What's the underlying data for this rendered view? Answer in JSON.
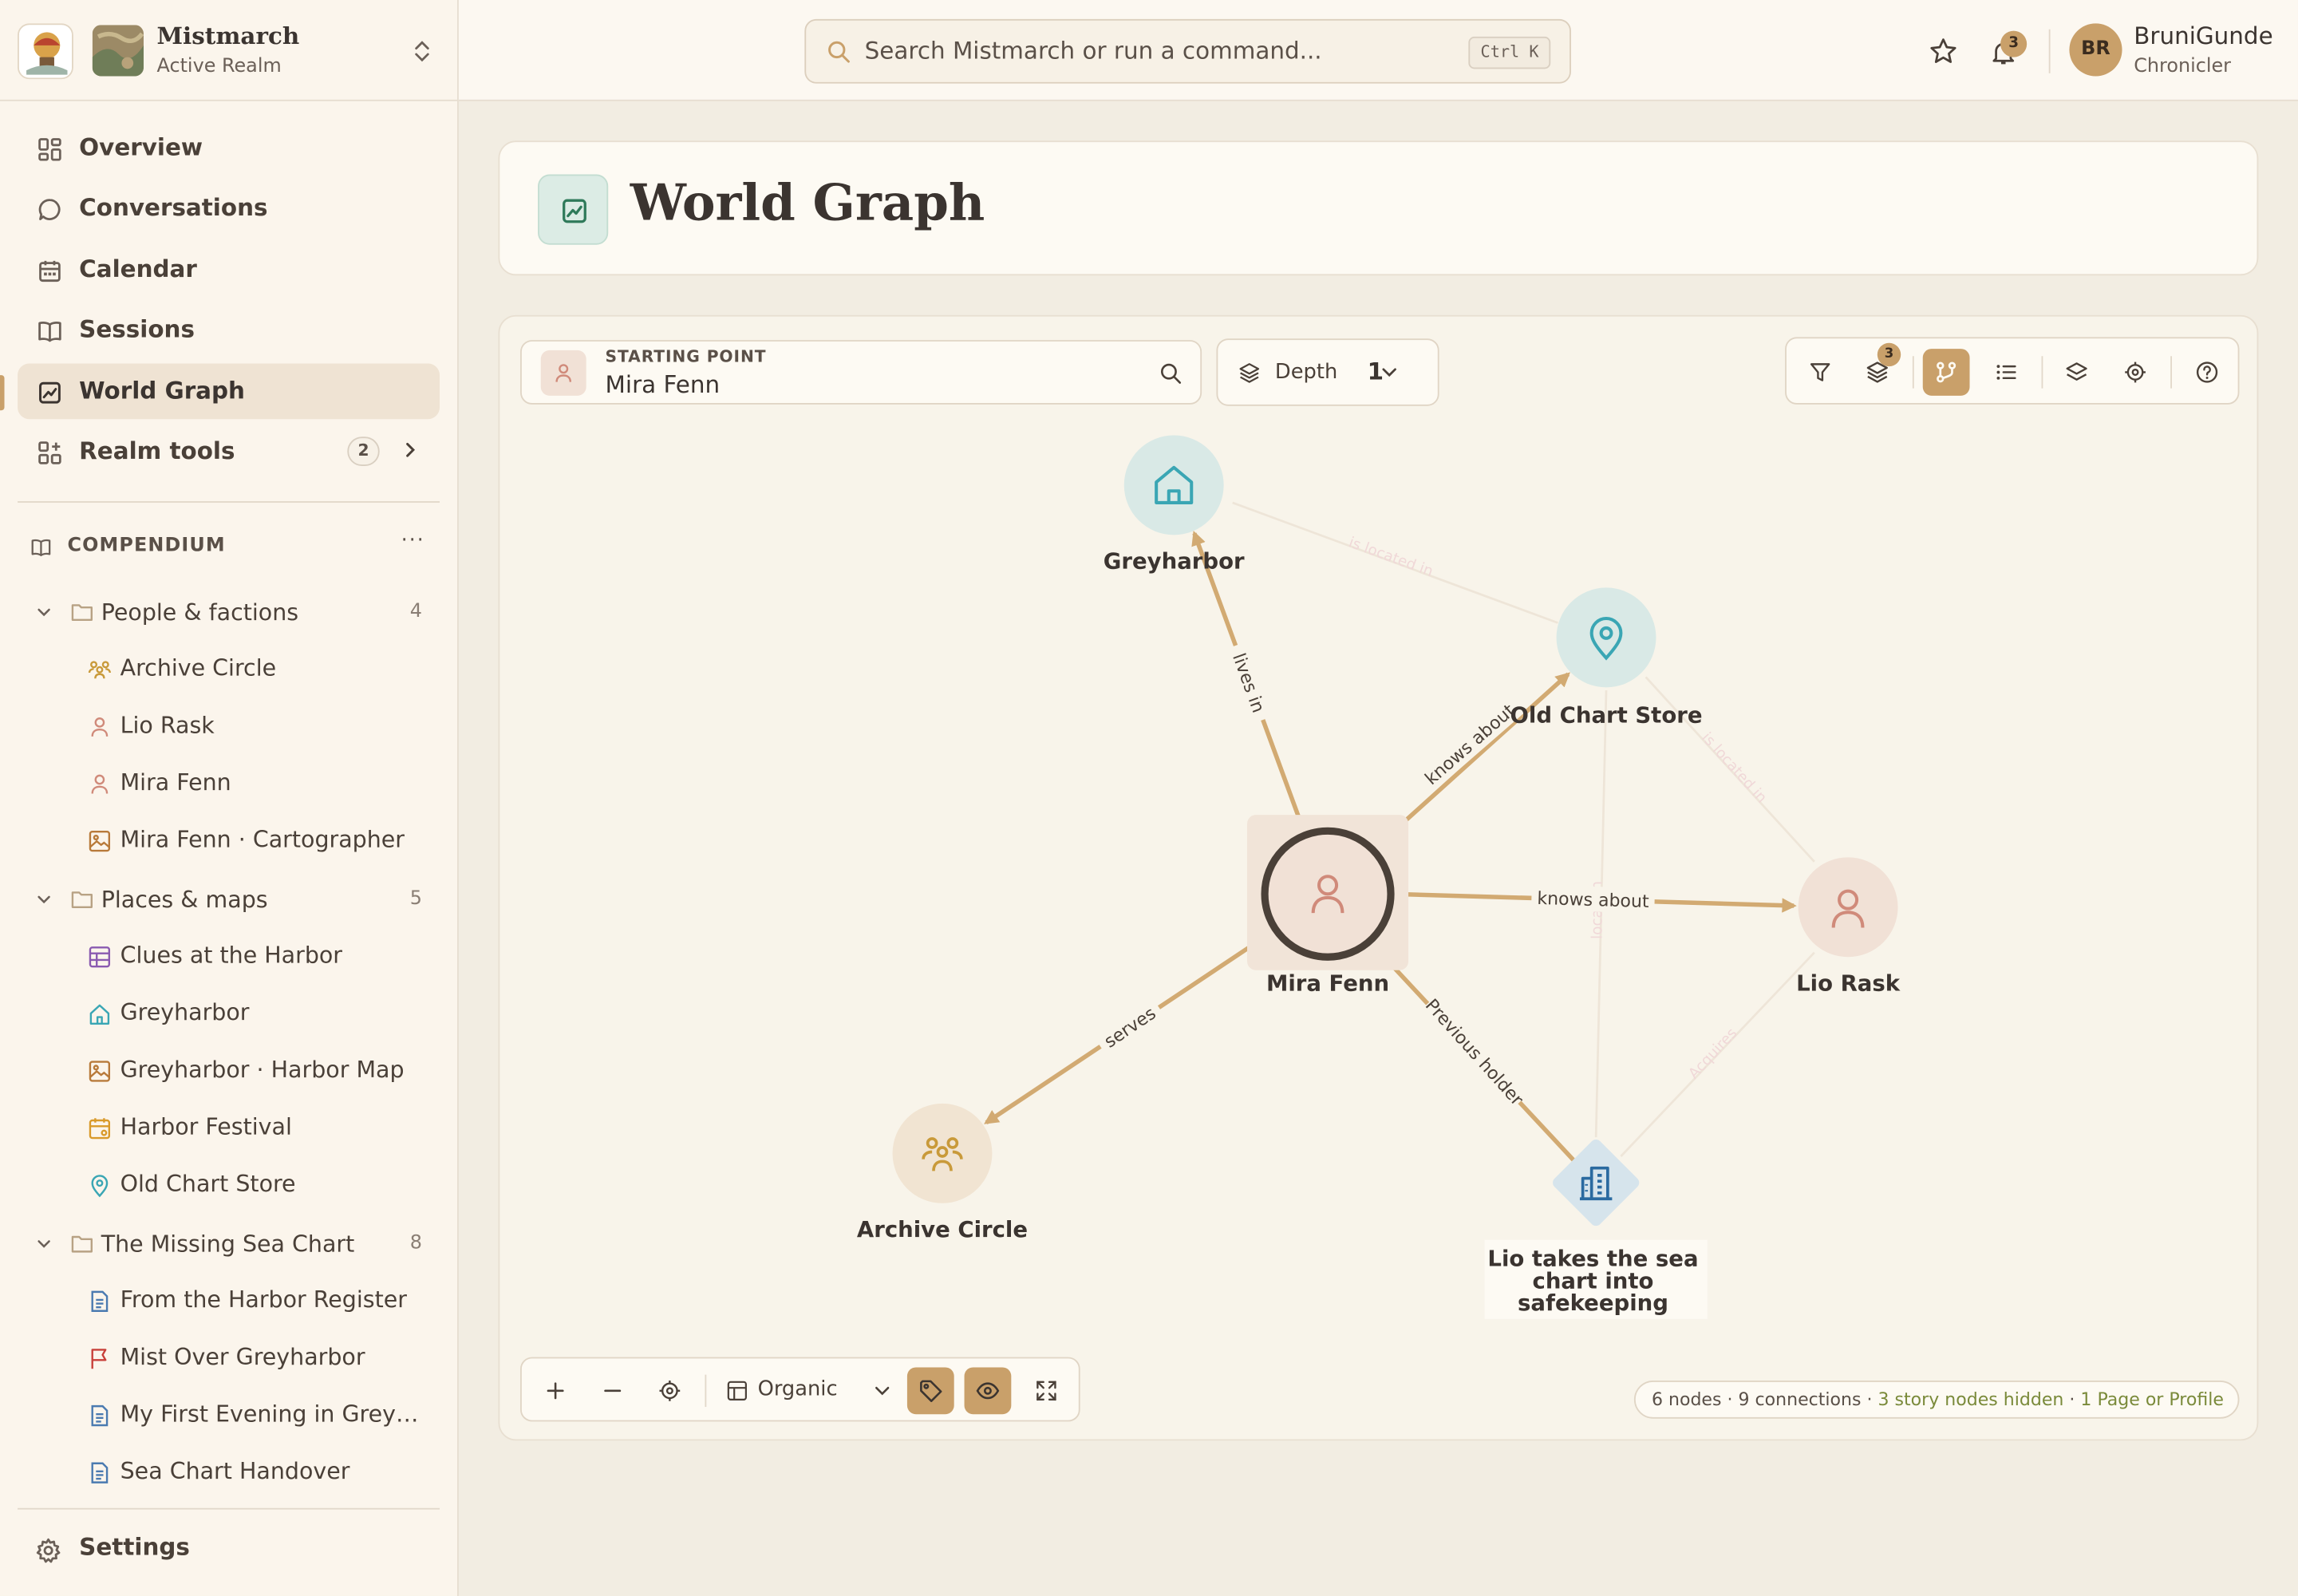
{
  "realm": {
    "name": "Mistmarch",
    "status": "Active Realm"
  },
  "nav": [
    {
      "label": "Overview",
      "icon": "grid-icon"
    },
    {
      "label": "Conversations",
      "icon": "chat-icon"
    },
    {
      "label": "Calendar",
      "icon": "calendar-icon"
    },
    {
      "label": "Sessions",
      "icon": "book-icon"
    },
    {
      "label": "World Graph",
      "icon": "graph-icon",
      "active": true
    },
    {
      "label": "Realm tools",
      "icon": "apps-icon",
      "badge": "2"
    }
  ],
  "compendium": {
    "title": "COMPENDIUM",
    "folders": [
      {
        "label": "People & factions",
        "count": "4",
        "items": [
          {
            "label": "Archive Circle",
            "icon": "group-icon"
          },
          {
            "label": "Lio Rask",
            "icon": "person-icon"
          },
          {
            "label": "Mira Fenn",
            "icon": "person-icon"
          },
          {
            "label": "Mira Fenn · Cartographer",
            "icon": "image-icon"
          }
        ]
      },
      {
        "label": "Places & maps",
        "count": "5",
        "items": [
          {
            "label": "Clues at the Harbor",
            "icon": "table-icon"
          },
          {
            "label": "Greyharbor",
            "icon": "home-icon"
          },
          {
            "label": "Greyharbor · Harbor Map",
            "icon": "image-icon"
          },
          {
            "label": "Harbor Festival",
            "icon": "calendar-icon"
          },
          {
            "label": "Old Chart Store",
            "icon": "pin-icon"
          }
        ]
      },
      {
        "label": "The Missing Sea Chart",
        "count": "8",
        "items": [
          {
            "label": "From the Harbor Register",
            "icon": "doc-icon"
          },
          {
            "label": "Mist Over Greyharbor",
            "icon": "flag-icon"
          },
          {
            "label": "My First Evening in Grey…",
            "icon": "doc-icon"
          },
          {
            "label": "Sea Chart Handover",
            "icon": "doc-icon"
          }
        ]
      }
    ]
  },
  "settings_label": "Settings",
  "search": {
    "placeholder": "Search Mistmarch or run a command...",
    "shortcut": "Ctrl K"
  },
  "notifications_count": "3",
  "user": {
    "initials": "BR",
    "name": "BruniGunde",
    "role": "Chronicler"
  },
  "page_title": "World Graph",
  "graph": {
    "starting_point_label": "STARTING POINT",
    "starting_point_value": "Mira Fenn",
    "depth_label": "Depth",
    "depth_value": "1",
    "filter_badge": "3",
    "layout": "Organic",
    "nodes": [
      {
        "id": "greyharbor",
        "label": "Greyharbor",
        "icon": "home-icon"
      },
      {
        "id": "oldchart",
        "label": "Old Chart Store",
        "icon": "pin-icon"
      },
      {
        "id": "mira",
        "label": "Mira Fenn",
        "icon": "person-icon"
      },
      {
        "id": "lio",
        "label": "Lio Rask",
        "icon": "person-icon"
      },
      {
        "id": "archive",
        "label": "Archive Circle",
        "icon": "group-icon"
      },
      {
        "id": "event",
        "label_lines": [
          "Lio takes the sea",
          "chart into",
          "safekeeping"
        ],
        "icon": "building-icon"
      }
    ],
    "edges": [
      {
        "from": "mira",
        "to": "greyharbor",
        "label": "lives in"
      },
      {
        "from": "mira",
        "to": "oldchart",
        "label": "knows about"
      },
      {
        "from": "mira",
        "to": "lio",
        "label": "knows about"
      },
      {
        "from": "mira",
        "to": "archive",
        "label": "serves"
      },
      {
        "from": "mira",
        "to": "event",
        "label": "Previous holder"
      },
      {
        "from": "greyharbor",
        "to": "oldchart",
        "label": "is located in",
        "faded": true
      },
      {
        "from": "lio",
        "to": "oldchart",
        "label": "is located in",
        "faded": true
      },
      {
        "from": "oldchart",
        "to": "event",
        "label": "location",
        "faded": true
      },
      {
        "from": "lio",
        "to": "event",
        "label": "Acquires",
        "faded": true
      }
    ],
    "stats": {
      "nodes": "6 nodes",
      "connections": "9 connections",
      "hidden": "3 story nodes hidden",
      "pages": "1 Page or Profile"
    }
  },
  "colors": {
    "accent": "#c9a06a",
    "edge": "#d2aa72",
    "sidebar_bg": "#fbf5ec",
    "canvas_bg": "#f8f4ea"
  }
}
